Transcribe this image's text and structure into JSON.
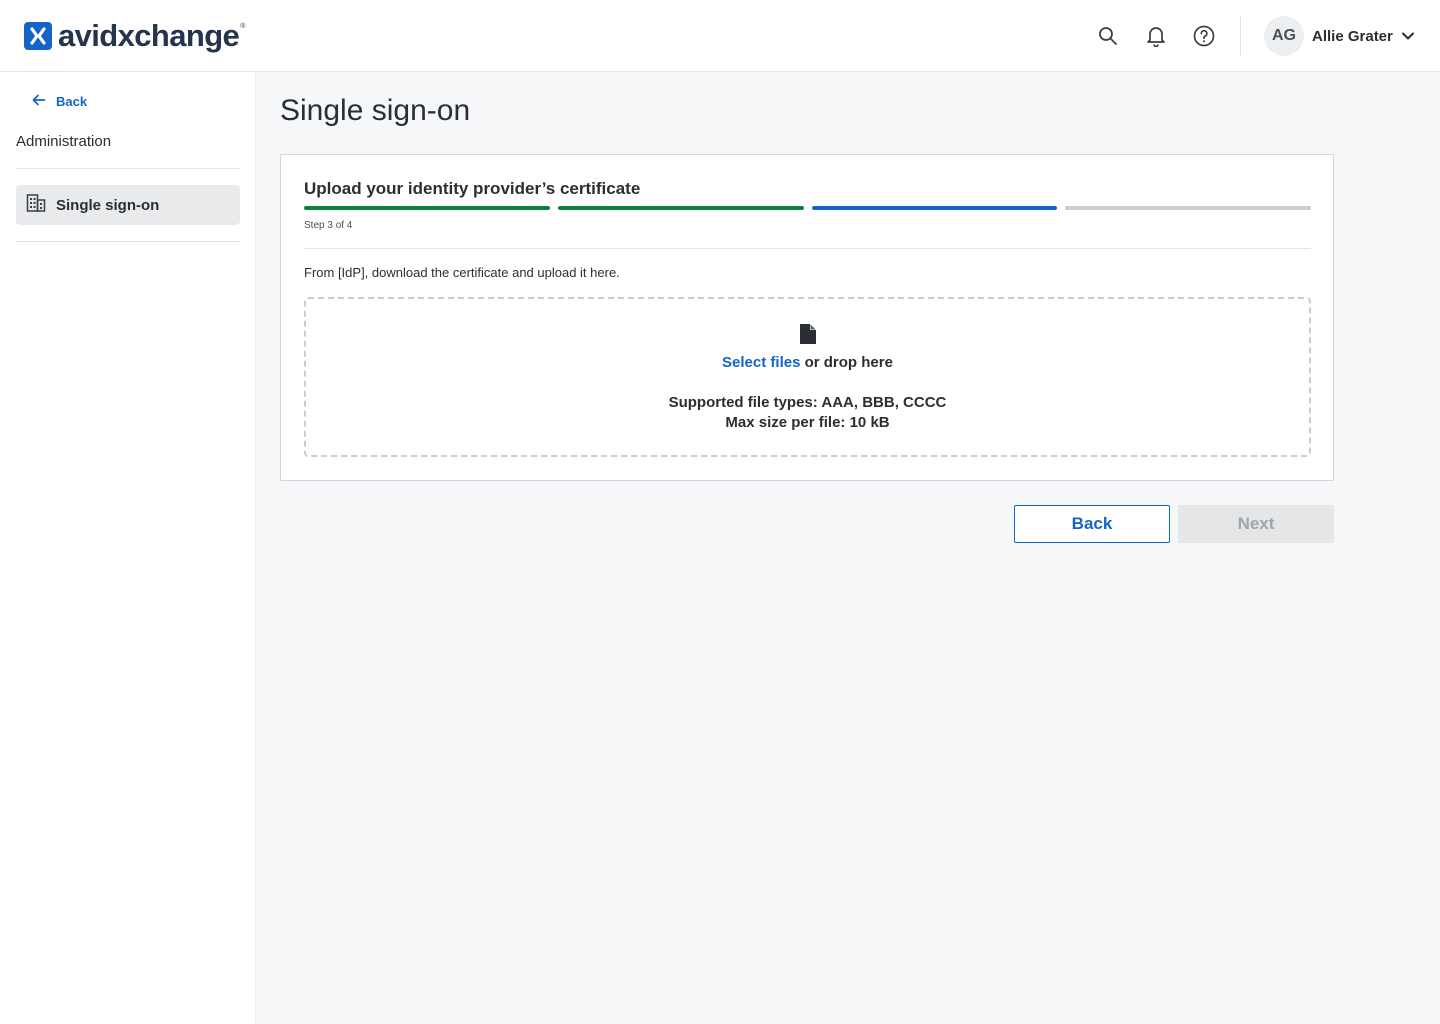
{
  "header": {
    "logo_text": "avidxchange",
    "logo_registered": "®",
    "icons": [
      "search-icon",
      "bell-icon",
      "help-icon"
    ],
    "user": {
      "initials": "AG",
      "name": "Allie Grater"
    }
  },
  "sidebar": {
    "back_label": "Back",
    "heading": "Administration",
    "items": [
      {
        "label": "Single sign-on",
        "icon": "building-icon",
        "active": true
      }
    ]
  },
  "main": {
    "title": "Single sign-on",
    "card": {
      "title": "Upload your identity provider’s certificate",
      "step_label": "Step 3 of 4",
      "step_current": 3,
      "step_total": 4,
      "instruction": "From [IdP], download the certificate and upload it here.",
      "dropzone": {
        "select_link": "Select files",
        "drop_text": " or drop here",
        "supported_types": "Supported file types: AAA, BBB, CCCC",
        "max_size": "Max size per file: 10 kB"
      }
    },
    "buttons": {
      "back": "Back",
      "next": "Next"
    }
  },
  "colors": {
    "brand": "#1565c8",
    "step_complete": "#0b8139",
    "step_current": "#1565c8",
    "step_pending": "#c9cdd1"
  }
}
